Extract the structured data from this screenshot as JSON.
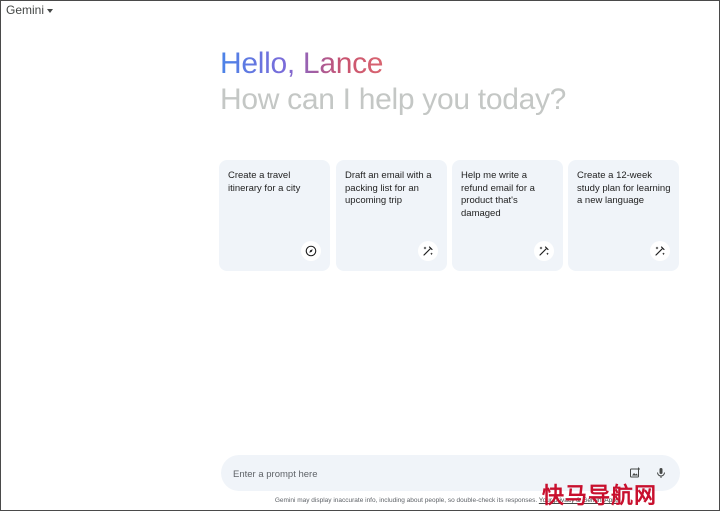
{
  "header": {
    "model_name": "Gemini"
  },
  "hero": {
    "greeting": "Hello, Lance",
    "subtitle": "How can I help you today?"
  },
  "suggestions": [
    {
      "text": "Create a travel itinerary for a city",
      "icon": "compass-icon"
    },
    {
      "text": "Draft an email with a packing list for an upcoming trip",
      "icon": "magic-pen-icon"
    },
    {
      "text": "Help me write a refund email for a product that's damaged",
      "icon": "magic-pen-icon"
    },
    {
      "text": "Create a 12-week study plan for learning a new language",
      "icon": "magic-pen-icon"
    }
  ],
  "prompt": {
    "placeholder": "Enter a prompt here",
    "value": ""
  },
  "footer": {
    "disclaimer": "Gemini may display inaccurate info, including about people, so double-check its responses.",
    "privacy_link": "Your privacy & Gemini Apps"
  },
  "watermark": "快马导航网",
  "colors": {
    "card_bg": "#f0f4f9",
    "subtitle": "#c4c7c5",
    "greeting_start": "#4b84e8",
    "greeting_end": "#d96570",
    "watermark": "#c8102e"
  }
}
